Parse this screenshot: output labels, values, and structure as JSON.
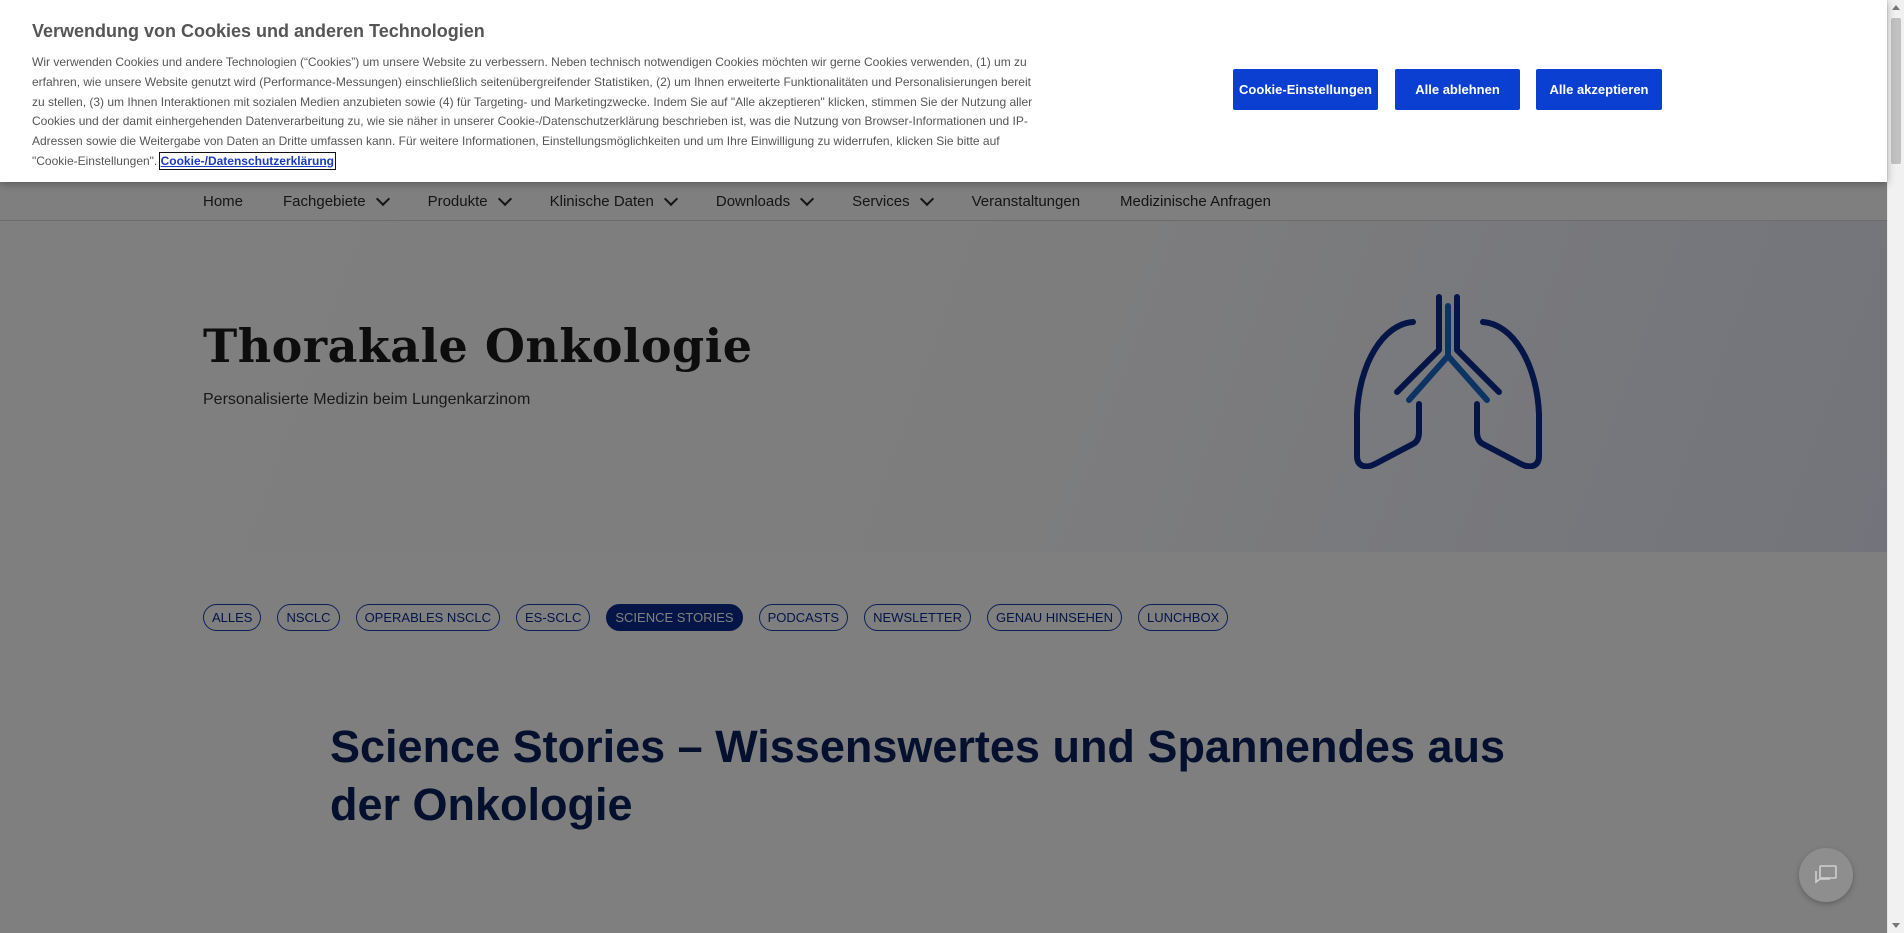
{
  "nav": {
    "items": [
      {
        "label": "Home",
        "dropdown": false
      },
      {
        "label": "Fachgebiete",
        "dropdown": true
      },
      {
        "label": "Produkte",
        "dropdown": true
      },
      {
        "label": "Klinische Daten",
        "dropdown": true
      },
      {
        "label": "Downloads",
        "dropdown": true
      },
      {
        "label": "Services",
        "dropdown": true
      },
      {
        "label": "Veranstaltungen",
        "dropdown": false
      },
      {
        "label": "Medizinische Anfragen",
        "dropdown": false
      }
    ]
  },
  "hero": {
    "title": "Thorakale Onkologie",
    "subtitle": "Personalisierte Medizin beim Lungenkarzinom",
    "icon": "lungs-icon",
    "icon_color": "#0b2a8f"
  },
  "filters": {
    "chips": [
      "ALLES",
      "NSCLC",
      "OPERABLES NSCLC",
      "ES-SCLC",
      "SCIENCE STORIES",
      "PODCASTS",
      "NEWSLETTER",
      "GENAU HINSEHEN",
      "LUNCHBOX"
    ],
    "active": "SCIENCE STORIES"
  },
  "section": {
    "title": "Science Stories – Wissenswertes und Spannendes aus der Onkologie"
  },
  "chat": {
    "icon": "chat-icon"
  },
  "cookie": {
    "title": "Verwendung von Cookies und anderen Technologien",
    "text": "Wir verwenden Cookies und andere Technologien (“Cookies”) um unsere Website zu verbessern. Neben technisch notwendigen Cookies möchten wir gerne Cookies verwenden, (1) um zu erfahren, wie unsere Website genutzt wird (Performance-Messungen) einschließlich seitenübergreifender Statistiken, (2) um Ihnen erweiterte Funktionalitäten und Personalisierungen bereit zu stellen, (3) um Ihnen Interaktionen mit sozialen Medien anzubieten sowie (4) für Targeting- und Marketingzwecke. Indem Sie auf \"Alle akzeptieren\" klicken, stimmen Sie der Nutzung aller Cookies und der damit einhergehenden Datenverarbeitung zu, wie sie näher in unserer Cookie-/Datenschutzerklärung beschrieben ist, was die Nutzung von Browser-Informationen und IP-Adressen sowie die Weitergabe von Daten an Dritte umfassen kann. Für weitere Informationen, Einstellungsmöglichkeiten und um Ihre Einwilligung zu widerrufen, klicken Sie bitte auf \"Cookie-Einstellungen\".",
    "link": "Cookie-/Datenschutzerklärung",
    "buttons": {
      "settings": "Cookie-Einstellungen",
      "reject": "Alle ablehnen",
      "accept": "Alle akzeptieren"
    },
    "button_color": "#0b3fd1"
  }
}
